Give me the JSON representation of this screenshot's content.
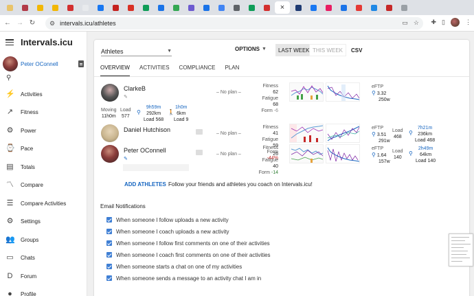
{
  "browser": {
    "url": "intervals.icu/athletes",
    "tab_colors": [
      "#e9c46a",
      "#b23a48",
      "#f2b705",
      "#f2b705",
      "#d32f2f",
      "#e8eaed",
      "#1877f2",
      "#c5221f",
      "#d93025",
      "#0f9d58",
      "#1a73e8",
      "#34a853",
      "#6d5bd0",
      "#1a73e8",
      "#4285f4",
      "#5f6368",
      "#0f9d58",
      "#d32f2f",
      "#1f3b73",
      "#1877f2",
      "#e91e63",
      "#1a73e8",
      "#e53935",
      "#1e88e5",
      "#c62828",
      "#9aa0a6"
    ],
    "close_glyph": "×"
  },
  "app": {
    "title": "Intervals.icu",
    "user_name": "Peter OConnell"
  },
  "nav": [
    {
      "label": "Activities",
      "icon": "activities-icon",
      "glyph": "⚡"
    },
    {
      "label": "Fitness",
      "icon": "trend-icon",
      "glyph": "↗"
    },
    {
      "label": "Power",
      "icon": "power-icon",
      "glyph": "⚙"
    },
    {
      "label": "Pace",
      "icon": "watch-icon",
      "glyph": "⌚"
    },
    {
      "label": "Totals",
      "icon": "totals-icon",
      "glyph": "▤"
    },
    {
      "label": "Compare",
      "icon": "compare-icon",
      "glyph": "〽"
    },
    {
      "label": "Compare Activities",
      "icon": "compare-list-icon",
      "glyph": "☰"
    },
    {
      "label": "Settings",
      "icon": "gear-icon",
      "glyph": "⚙"
    },
    {
      "label": "Groups",
      "icon": "groups-icon",
      "glyph": "👥"
    },
    {
      "label": "Chats",
      "icon": "chat-icon",
      "glyph": "▭"
    },
    {
      "label": "Forum",
      "icon": "forum-icon",
      "glyph": "D"
    },
    {
      "label": "Profile",
      "icon": "profile-icon",
      "glyph": "●"
    }
  ],
  "header": {
    "select_value": "Athletes",
    "options_label": "OPTIONS",
    "last_week": "LAST WEEK",
    "this_week": "THIS WEEK",
    "csv": "CSV"
  },
  "tabs": [
    "OVERVIEW",
    "ACTIVITIES",
    "COMPLIANCE",
    "PLAN"
  ],
  "athletes": [
    {
      "name": "ClarkeB",
      "plan": "– No plan –",
      "fitness_label": "Fitness",
      "fitness": "62",
      "fatigue_label": "Fatigue",
      "fatigue": "68",
      "form_label": "Form",
      "form": "-6",
      "eftp_label": "eFTP",
      "eftp_1": "3.32",
      "eftp_2": "250w",
      "moving_label": "Moving",
      "moving": "11h0m",
      "load_label": "Load",
      "load": "577",
      "ride_time": "9h59m",
      "ride_dist": "292km",
      "ride_load": "Load 568",
      "walk_time": "1h0m",
      "walk_dist": "6km",
      "walk_load": "Load 9"
    },
    {
      "name": "Daniel Hutchison",
      "plan": "– No plan –",
      "fitness_label": "Fitness",
      "fitness": "41",
      "fatigue_label": "Fatigue",
      "fatigue": "59",
      "form_label": "Form",
      "form": "-44%",
      "eftp_label": "eFTP",
      "eftp_1": "3.51",
      "eftp_2": "291w",
      "load_label": "Load",
      "load": "468",
      "ride_time": "7h21m",
      "ride_dist": "236km",
      "ride_load": "Load 468"
    },
    {
      "name": "Peter OConnell",
      "plan": "– No plan –",
      "fitness_label": "Fitness",
      "fitness": "26",
      "fatigue_label": "Fatigue",
      "fatigue": "40",
      "form_label": "Form",
      "form": "-14",
      "eftp_label": "eFTP",
      "eftp_1": "1.64",
      "eftp_2": "157w",
      "load_label": "Load",
      "load": "140",
      "ride_time": "2h49m",
      "ride_dist": "64km",
      "ride_load": "Load 140"
    }
  ],
  "add_athletes": "ADD ATHLETES",
  "follow_text": "Follow your friends and athletes you coach on Intervals.icu!",
  "email": {
    "heading": "Email Notifications",
    "items": [
      "When someone I follow uploads a new activity",
      "When someone I coach uploads a new activity",
      "When someone I follow first comments on one of their activities",
      "When someone I coach first comments on one of their activities",
      "When someone starts a chat on one of my activities",
      "When someone sends a message to an activity chat I am in"
    ]
  }
}
